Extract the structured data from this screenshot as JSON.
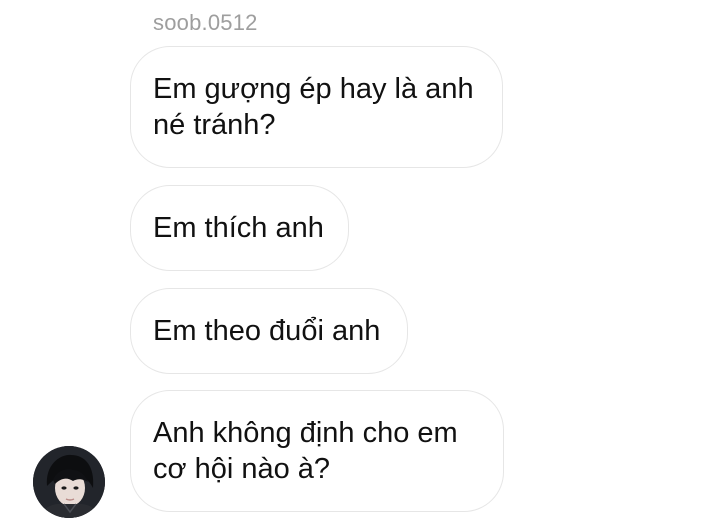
{
  "thread": {
    "sender": "soob.0512",
    "messages": [
      {
        "text": "Em gượng ép hay là anh né tránh?"
      },
      {
        "text": "Em thích anh"
      },
      {
        "text": "Em theo đuổi anh"
      },
      {
        "text": "Anh không định cho em cơ hội nào à?"
      }
    ],
    "avatar_icon": "user-avatar-photo"
  }
}
